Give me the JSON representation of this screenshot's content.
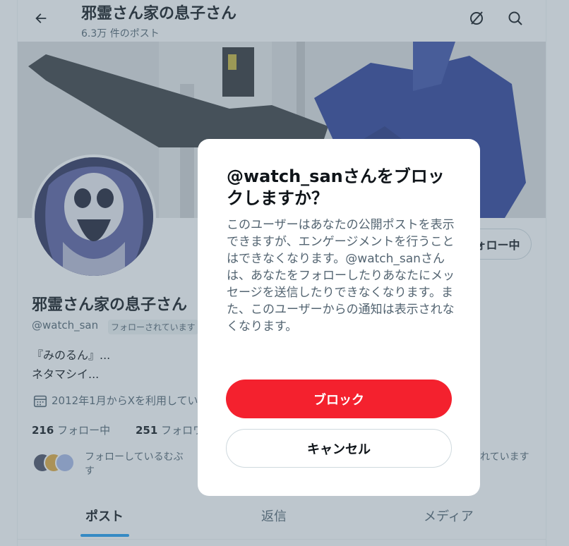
{
  "header": {
    "title": "邪霊さん家の息子さん",
    "post_count": "6.3万 件のポスト"
  },
  "profile": {
    "follow_button": "フォロー中",
    "name": "邪霊さん家の息子さん",
    "handle": "@watch_san",
    "follows_you": "フォローされています",
    "bio_line1": "『みのるん』...",
    "bio_line2": "ネタマシイ...",
    "joined": "2012年1月からXを利用しています",
    "following_count": "216",
    "following_label": "フォロー中",
    "followers_count": "251",
    "followers_label": "フォロワー",
    "known_followers_line1": "フォローしているむぶ",
    "known_followers_line2": "す",
    "known_followers_tail": "れています"
  },
  "tabs": [
    {
      "label": "ポスト"
    },
    {
      "label": "返信"
    },
    {
      "label": "メディア"
    }
  ],
  "modal": {
    "title": "@watch_sanさんをブロックしますか？",
    "body": "このユーザーはあなたの公開ポストを表示できますが、エンゲージメントを行うことはできなくなります。@watch_sanさんは、あなたをフォローしたりあなたにメッセージを送信したりできなくなります。また、このユーザーからの通知は表示されなくなります。",
    "block_label": "ブロック",
    "cancel_label": "キャンセル"
  },
  "colors": {
    "block_red": "#f4212e",
    "tab_indicator": "#1d9bf0",
    "overlay": "rgba(91,112,131,0.4)"
  },
  "icons": [
    "back-arrow-icon",
    "grok-icon",
    "search-icon",
    "calendar-icon"
  ]
}
